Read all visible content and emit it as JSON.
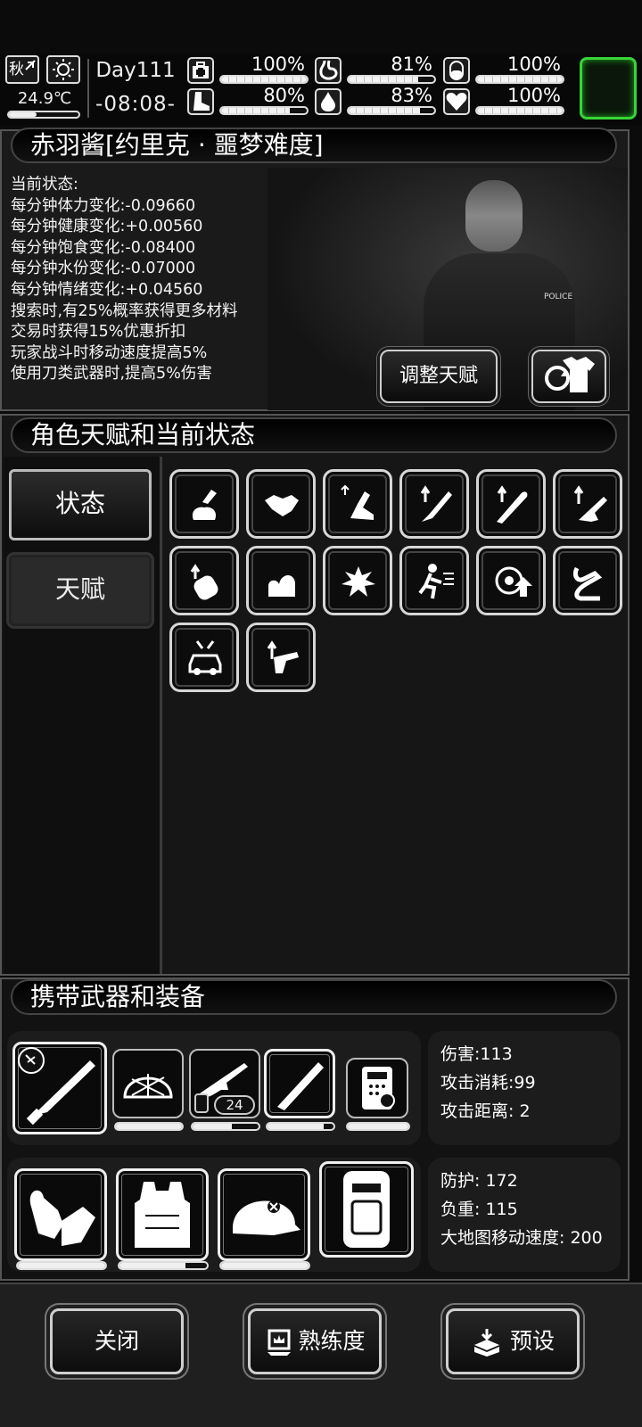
{
  "topbar": {
    "season": "秋",
    "temperature": "24.9℃",
    "temperature_level": 0.4,
    "day": "Day111",
    "time": "-08:08-",
    "stats": [
      {
        "name": "health",
        "icon": "medkit-icon",
        "value": "100%",
        "level": 1.0
      },
      {
        "name": "hunger",
        "icon": "stomach-icon",
        "value": "81%",
        "level": 0.81
      },
      {
        "name": "energy",
        "icon": "pill-icon",
        "value": "100%",
        "level": 1.0
      },
      {
        "name": "stamina",
        "icon": "boot-icon",
        "value": "80%",
        "level": 0.8
      },
      {
        "name": "water",
        "icon": "water-drop-icon",
        "value": "83%",
        "level": 0.83
      },
      {
        "name": "mood",
        "icon": "heart-icon",
        "value": "100%",
        "level": 1.0
      }
    ]
  },
  "character": {
    "title": "赤羽酱[约里克 · 噩梦难度]",
    "status_lines": [
      "当前状态:",
      "每分钟体力变化:-0.09660",
      "每分钟健康变化:+0.00560",
      "每分钟饱食变化:-0.08400",
      "每分钟水份变化:-0.07000",
      "每分钟情绪变化:+0.04560",
      "搜索时,有25%概率获得更多材料",
      "交易时获得15%优惠折扣",
      "玩家战斗时移动速度提高5%",
      "使用刀类武器时,提高5%伤害"
    ],
    "adjust_talent_label": "调整天赋",
    "police_badge": "POLICE"
  },
  "talents": {
    "header": "角色天赋和当前状态",
    "tabs": [
      "状态",
      "天赋"
    ],
    "icons": [
      "scavenge-bag-icon",
      "handshake-icon",
      "sprint-icon",
      "knife-up-icon",
      "bat-up-icon",
      "gun-up-icon",
      "fist-up-icon",
      "strength-arm-icon",
      "explosion-icon",
      "dodge-run-icon",
      "target-up-icon",
      "crowbar-icon",
      "car-repair-icon",
      "pistol-up-icon"
    ]
  },
  "equipment": {
    "header": "携带武器和装备",
    "weapon_slots": [
      {
        "icon": "machete-icon",
        "durability": 0
      },
      {
        "icon": "net-helmet-icon",
        "durability": 1.0
      },
      {
        "icon": "rifle-icon",
        "ammo": "24",
        "durability": 0.6
      },
      {
        "icon": "machete-icon",
        "durability": 0.85
      },
      {
        "icon": "phone-icon",
        "durability": 1.0
      }
    ],
    "armor_slots": [
      {
        "icon": "gloves-icon",
        "durability": 1.0
      },
      {
        "icon": "vest-icon",
        "durability": 0.75
      },
      {
        "icon": "helmet-icon",
        "durability": 1.0
      },
      {
        "icon": "backpack-icon",
        "durability": 0
      }
    ],
    "weapon_stats": [
      "伤害:113",
      "攻击消耗:99",
      "攻击距离: 2"
    ],
    "armor_stats": [
      "防护: 172",
      "负重: 115",
      "大地图移动速度: 200"
    ]
  },
  "footer": {
    "close_label": "关闭",
    "proficiency_label": "熟练度",
    "preset_label": "预设"
  }
}
